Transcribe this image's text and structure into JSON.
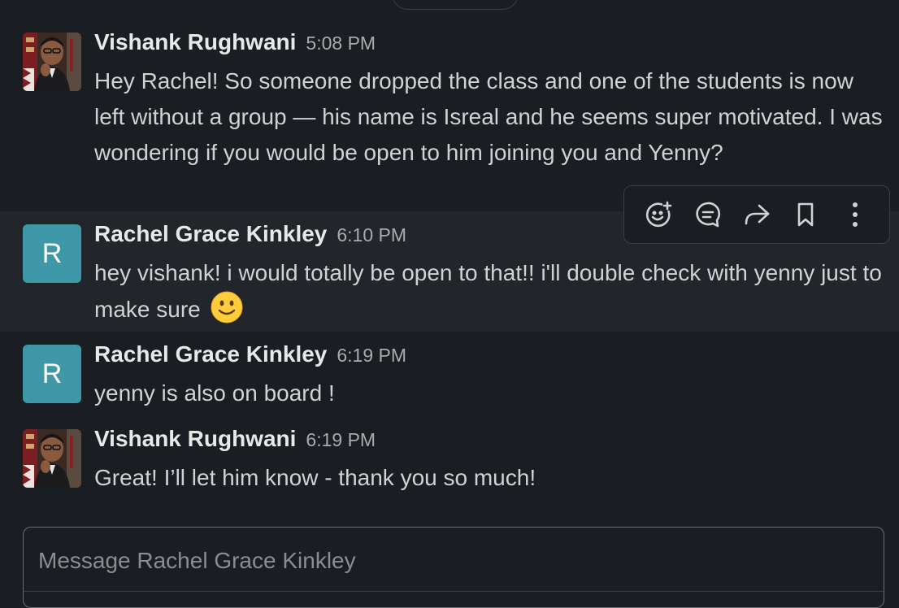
{
  "messages": [
    {
      "sender": "Vishank Rughwani",
      "time": "5:08 PM",
      "avatar": "photo",
      "text": "Hey Rachel! So someone dropped the class and one of the students is now left without a group — his name is Isreal and he seems super motivated. I was wondering if you would be open to him joining you and Yenny?"
    },
    {
      "sender": "Rachel Grace Kinkley",
      "time": "6:10 PM",
      "avatar": "letter",
      "avatar_letter": "R",
      "text": "hey vishank! i would totally be open to that!! i'll double check with yenny just to make sure",
      "emoji": "slightly-smiling-face"
    },
    {
      "sender": "Rachel Grace Kinkley",
      "time": "6:19 PM",
      "avatar": "letter",
      "avatar_letter": "R",
      "text": "yenny is also on board !"
    },
    {
      "sender": "Vishank Rughwani",
      "time": "6:19 PM",
      "avatar": "photo",
      "text": "Great! I’ll let him know - thank you so much!"
    }
  ],
  "hover_toolbar": {
    "icons": [
      "add-reaction-icon",
      "reply-in-thread-icon",
      "forward-icon",
      "save-bookmark-icon",
      "more-actions-icon"
    ]
  },
  "composer": {
    "placeholder": "Message Rachel Grace Kinkley",
    "value": ""
  },
  "colors": {
    "background": "#1a1d21",
    "highlight_row": "#222529",
    "avatar_letter_bg": "#3e98a8",
    "text": "#d1d2d3",
    "timestamp": "#a9abad"
  }
}
